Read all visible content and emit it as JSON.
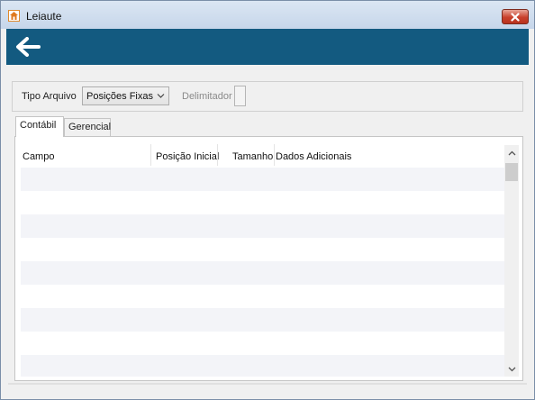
{
  "window": {
    "title": "Leiaute",
    "app_icon": "app-logo-icon",
    "close_icon": "close-icon"
  },
  "header": {
    "back_icon": "back-arrow-icon",
    "color": "#135a80"
  },
  "options": {
    "tipo_label": "Tipo Arquivo",
    "tipo_value": "Posições Fixas",
    "delimitador_label": "Delimitador",
    "delimitador_value": ""
  },
  "tabs": [
    {
      "label": "Contábil",
      "active": true
    },
    {
      "label": "Gerencial",
      "active": false
    }
  ],
  "grid": {
    "columns": [
      "Campo",
      "Posição Inicial",
      "Tamanho",
      "Dados Adicionais"
    ],
    "rows": []
  }
}
